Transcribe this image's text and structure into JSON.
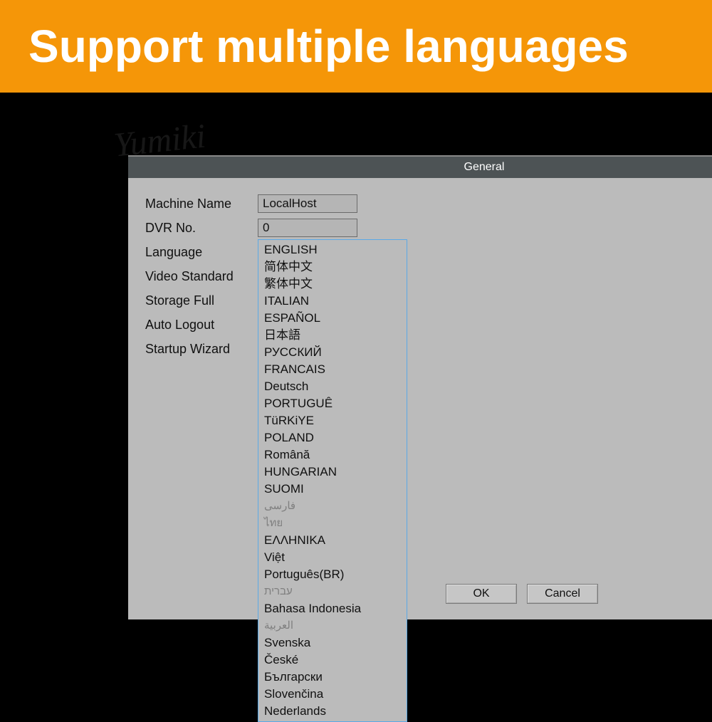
{
  "banner": {
    "title": "Support multiple languages"
  },
  "dialog": {
    "title": "General",
    "fields": {
      "machine_name": {
        "label": "Machine Name",
        "value": "LocalHost"
      },
      "dvr_no": {
        "label": "DVR No.",
        "value": "0"
      },
      "language": {
        "label": "Language",
        "selected": "ENGLISH"
      },
      "video_standard": {
        "label": "Video Standard"
      },
      "storage_full": {
        "label": "Storage Full"
      },
      "auto_logout": {
        "label": "Auto Logout"
      },
      "startup_wizard": {
        "label": "Startup Wizard"
      }
    },
    "language_options": [
      "ENGLISH",
      "简体中文",
      "繁体中文",
      "ITALIAN",
      "ESPAÑOL",
      "日本語",
      "РУССКИЙ",
      "FRANCAIS",
      "Deutsch",
      "PORTUGUÊ",
      "TüRKiYE",
      "POLAND",
      "Română",
      "HUNGARIAN",
      "SUOMI",
      "فارسی",
      "ไทย",
      "ΕΛΛΗΝΙΚΑ",
      "Việt",
      "Português(BR)",
      "עברית",
      "Bahasa Indonesia",
      "العربية",
      "Svenska",
      "České",
      "Български",
      "Slovenčina",
      "Nederlands"
    ],
    "buttons": {
      "ok": "OK",
      "cancel": "Cancel"
    }
  },
  "watermark": "Yumiki"
}
